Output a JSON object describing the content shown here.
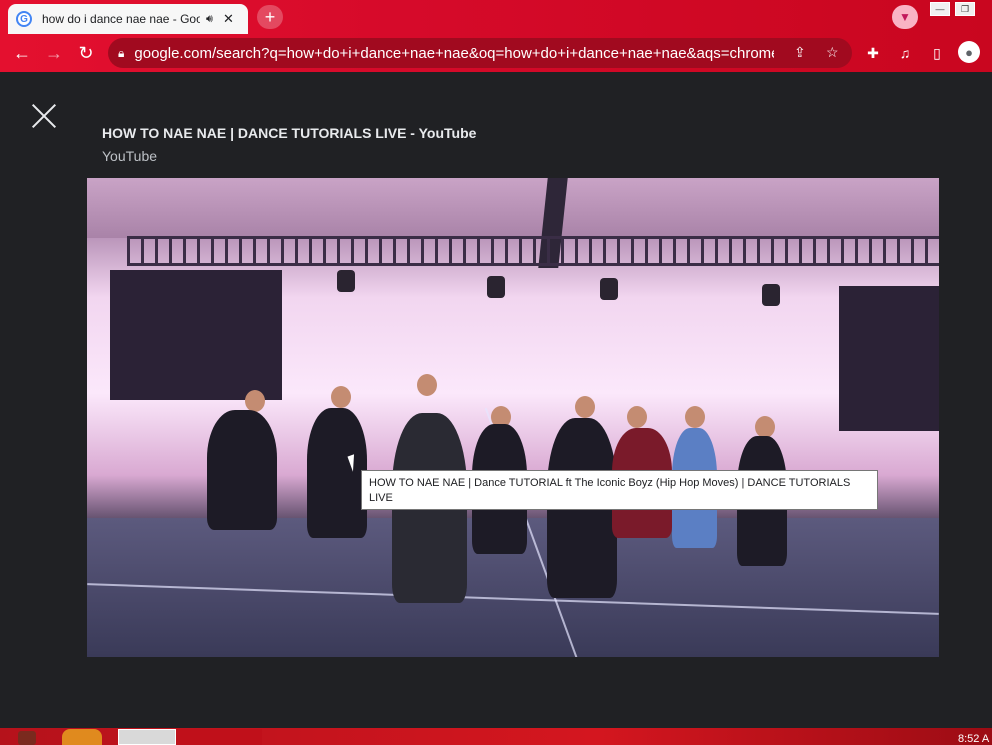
{
  "tab": {
    "title": "how do i dance nae nae - Google Search",
    "audio_icon": "speaker-icon",
    "close_glyph": "✕"
  },
  "newtab": {
    "glyph": "+"
  },
  "omnibox": {
    "url": "google.com/search?q=how+do+i+dance+nae+nae&oq=how+do+i+dance+nae+nae&aqs=chrome....."
  },
  "viewer": {
    "title": "HOW TO NAE NAE | DANCE TUTORIALS LIVE - YouTube",
    "source": "YouTube"
  },
  "tooltip": {
    "text": "HOW TO NAE NAE | Dance TUTORIAL ft The Iconic Boyz (Hip Hop Moves) | DANCE TUTORIALS LIVE"
  },
  "taskbar": {
    "clock": "8:52 A"
  },
  "colors": {
    "chrome_red": "#d60a2a",
    "viewer_bg": "#202124"
  }
}
